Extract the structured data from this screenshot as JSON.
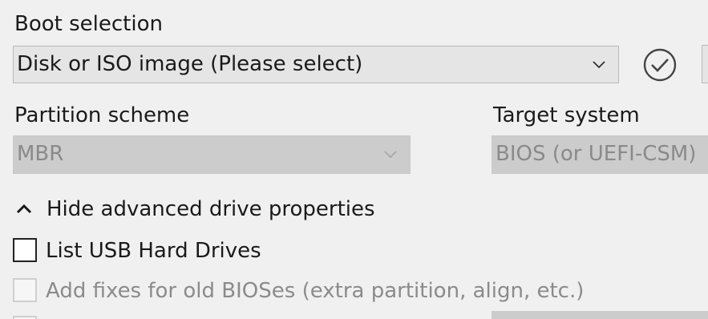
{
  "boot_selection": {
    "label": "Boot selection",
    "value": "Disk or ISO image (Please select)",
    "icon": "chevron-down-icon",
    "check_icon": "check-circle-icon"
  },
  "partition_scheme": {
    "label": "Partition scheme",
    "value": "MBR",
    "enabled": false
  },
  "target_system": {
    "label": "Target system",
    "value": "BIOS (or UEFI-CSM)",
    "enabled": false
  },
  "advanced": {
    "toggle_label": "Hide advanced drive properties",
    "icon": "chevron-up-icon"
  },
  "options": {
    "list_usb": {
      "label": "List USB Hard Drives",
      "checked": false,
      "enabled": true
    },
    "old_bios_fixes": {
      "label": "Add fixes for old BIOSes (extra partition, align, etc.)",
      "checked": false,
      "enabled": false
    }
  },
  "colors": {
    "background": "#f0f0f0",
    "combo_bg": "#e5e5e5",
    "disabled_bg": "#cccccc",
    "disabled_text": "#8a8a8a"
  }
}
